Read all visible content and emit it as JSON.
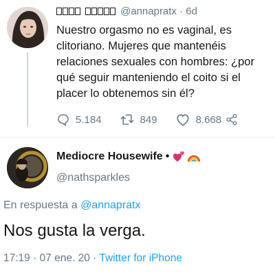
{
  "tweet1": {
    "author_handle": "@annapratx",
    "separator": "·",
    "age": "6d",
    "text": "Nuestro orgasmo no es vaginal, es clitoriano. Mujeres que mantenéis relaciones sexuales con hombres: ¿por qué seguir manteniendo el coito si el placer lo obtenemos sin él?",
    "replies": "5.184",
    "retweets": "849",
    "likes": "8.668",
    "icons": [
      "reply-icon",
      "retweet-icon",
      "like-icon",
      "share-icon"
    ]
  },
  "tweet2": {
    "author_name": "Mediocre Housewife",
    "name_bullet": "•",
    "emojis": [
      "two-hearts-icon",
      "rainbow-icon"
    ],
    "author_handle": "@nathsparkles",
    "reply_prefix": "En respuesta a",
    "reply_to": "@annapratx",
    "text": "Nos gusta la verga.",
    "time": "17:19",
    "date_sep": "·",
    "date": "07 ene. 20",
    "via_sep": "·",
    "source": "Twitter for iPhone"
  },
  "colors": {
    "text": "#14171a",
    "muted": "#657786",
    "link": "#1da1f2",
    "divider": "#e6ecf0"
  }
}
